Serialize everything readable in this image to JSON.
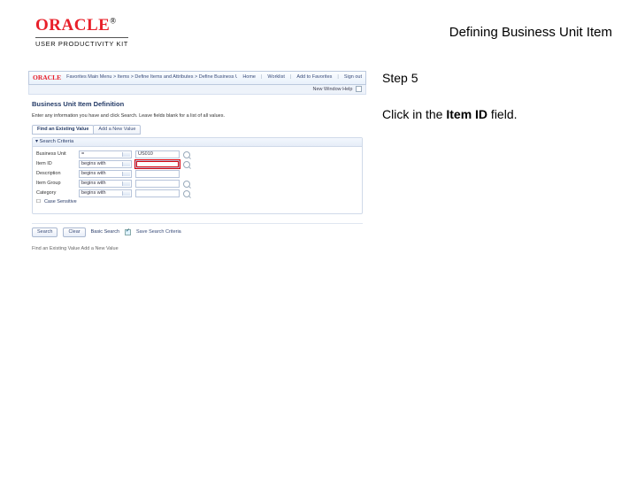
{
  "header": {
    "logo_main": "ORACLE",
    "logo_trade": "®",
    "logo_sub": "USER PRODUCTIVITY KIT",
    "page_title": "Defining Business Unit Item"
  },
  "sidebar": {
    "step_label": "Step 5",
    "instruction_pre": "Click in the ",
    "instruction_bold": "Item ID",
    "instruction_post": " field."
  },
  "shot": {
    "logo": "ORACLE",
    "breadcrumb": "Favorites    Main Menu  >  Items  >  Define Items and Attributes  >  Define Business Unit Item",
    "topright": [
      "Home",
      "Worklist",
      "Add to Favorites",
      "Sign out"
    ],
    "subbar_label": "New Window   Help",
    "page_heading": "Business Unit Item Definition",
    "page_desc": "Enter any information you have and click Search. Leave fields blank for a list of all values.",
    "tabs": [
      "Find an Existing Value",
      "Add a New Value"
    ],
    "section_title": "▾ Search Criteria",
    "fields": {
      "bu": {
        "label": "Business Unit",
        "op": "=",
        "value": "US010",
        "star": ""
      },
      "item": {
        "label": "Item ID",
        "op": "begins with",
        "value": "",
        "star": ""
      },
      "desc": {
        "label": "Description",
        "op": "begins with",
        "value": "",
        "star": ""
      },
      "group": {
        "label": "Item Group",
        "op": "begins with",
        "value": "",
        "star": ""
      },
      "cat": {
        "label": "Category",
        "op": "begins with",
        "value": "",
        "star": ""
      }
    },
    "case_label": "Case Sensitive",
    "actions": {
      "search": "Search",
      "clear": "Clear",
      "basic": "Basic Search",
      "save_label": "Save Search Criteria"
    },
    "footer": "Find an Existing Value   Add a New Value"
  }
}
